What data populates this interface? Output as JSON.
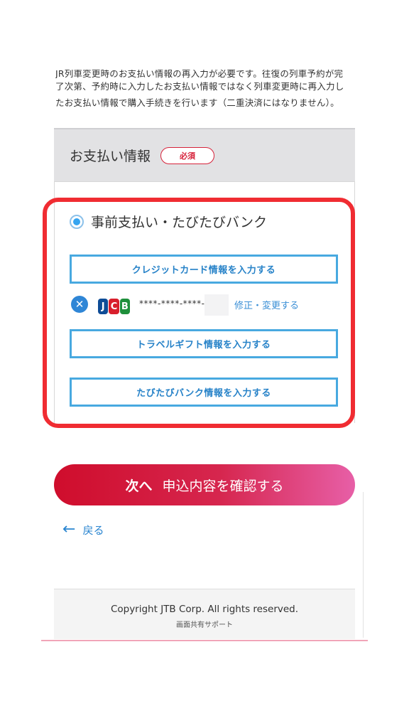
{
  "notice": {
    "line_cut": "JR列車変更時のお支払い情報の再入力が必要です。往復の列車予約が完",
    "line2": "了次第、予約時に入力したお支払い情報ではなく列車変更時に再入力し",
    "line3": "たお支払い情報で購入手続きを行います（二重決済にはなりません）。"
  },
  "payment": {
    "section_title": "お支払い情報",
    "required_badge": "必須",
    "option_label": "事前支払い・たびたびバンク",
    "credit_button": "クレジットカード情報を入力する",
    "card": {
      "brand_letters": [
        "J",
        "C",
        "B"
      ],
      "number": "****-****-****-",
      "edit_link": "修正・変更する"
    },
    "travel_gift_button": "トラベルギフト情報を入力する",
    "tabitabi_button": "たびたびバンク情報を入力する"
  },
  "actions": {
    "next_strong": "次へ",
    "next_label": "申込内容を確認する",
    "back_label": "戻る"
  },
  "footer": {
    "copyright": "Copyright JTB Corp. All rights reserved.",
    "support": "画面共有サポート"
  },
  "colors": {
    "accent_red": "#f02c32",
    "button_blue": "#48a9e0",
    "link_blue": "#3a8fd6",
    "gradient_start": "#cf0d2c",
    "gradient_end": "#e75fa7"
  }
}
